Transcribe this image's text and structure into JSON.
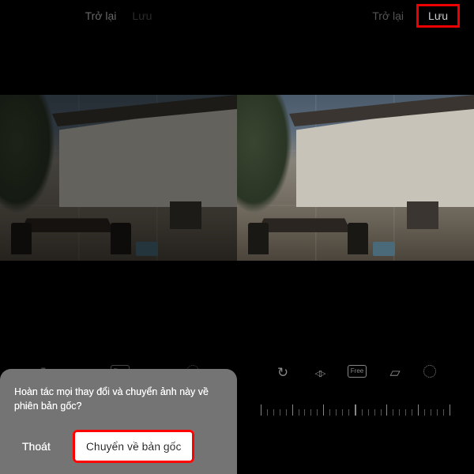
{
  "header": {
    "back": "Trở lại",
    "save": "Lưu"
  },
  "toolbar": {
    "free_label": "Free"
  },
  "dialog": {
    "message": "Hoàn tác mọi thay đổi và chuyển ảnh này về phiên bản gốc?",
    "exit": "Thoát",
    "revert": "Chuyển về bản gốc"
  }
}
